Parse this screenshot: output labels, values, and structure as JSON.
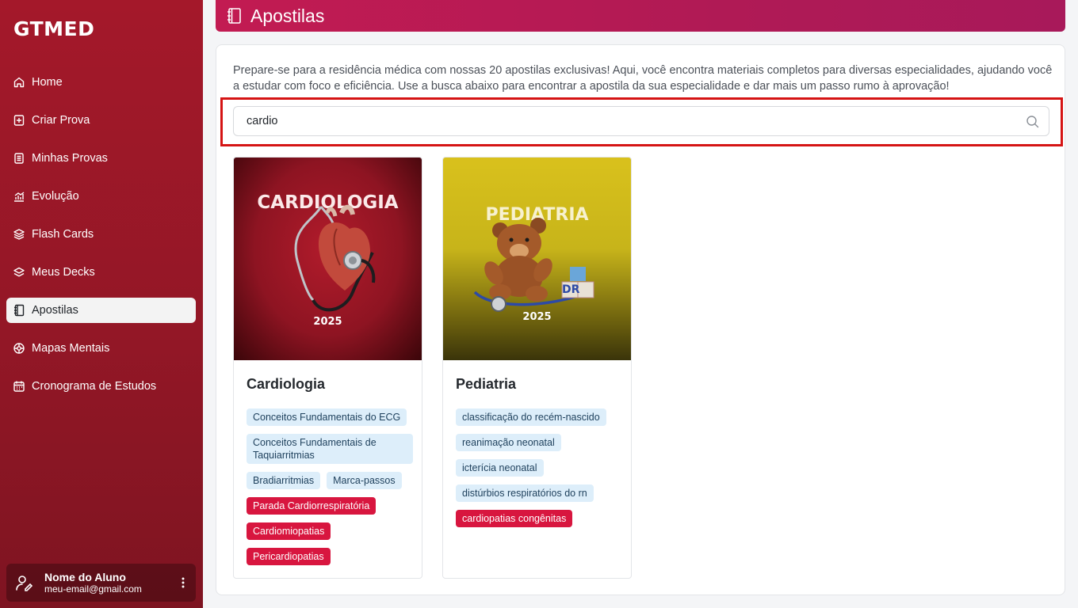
{
  "app": {
    "brand": "GTMED"
  },
  "sidebar": {
    "items": [
      {
        "label": "Home",
        "icon": "home-icon"
      },
      {
        "label": "Criar Prova",
        "icon": "plus-square-icon"
      },
      {
        "label": "Minhas Provas",
        "icon": "document-icon"
      },
      {
        "label": "Evolução",
        "icon": "chart-icon"
      },
      {
        "label": "Flash Cards",
        "icon": "layers-icon"
      },
      {
        "label": "Meus Decks",
        "icon": "stack-icon"
      },
      {
        "label": "Apostilas",
        "icon": "notebook-icon",
        "active": true
      },
      {
        "label": "Mapas Mentais",
        "icon": "mindmap-icon"
      },
      {
        "label": "Cronograma de Estudos",
        "icon": "calendar-icon"
      }
    ]
  },
  "user": {
    "name": "Nome do Aluno",
    "email": "meu-email@gmail.com"
  },
  "header": {
    "title": "Apostilas"
  },
  "main": {
    "description": "Prepare-se para a residência médica com nossas 20 apostilas exclusivas! Aqui, você encontra materiais completos para diversas especialidades, ajudando você a estudar com foco e eficiência. Use a busca abaixo para encontrar a apostila da sua especialidade e dar mais um passo rumo à aprovação!",
    "search": {
      "value": "cardio",
      "placeholder": ""
    }
  },
  "cards": [
    {
      "title": "Cardiologia",
      "cover_title": "CARDIOLOGIA",
      "cover_year": "2025",
      "tags": [
        {
          "label": "Conceitos Fundamentais do ECG",
          "highlight": false
        },
        {
          "label": "Conceitos Fundamentais de Taquiarritmias",
          "highlight": false
        },
        {
          "label": "Bradiarritmias",
          "highlight": false
        },
        {
          "label": "Marca-passos",
          "highlight": false
        },
        {
          "label": "Parada Cardiorrespiratória",
          "highlight": true
        },
        {
          "label": "Cardiomiopatias",
          "highlight": true
        },
        {
          "label": "Pericardiopatias",
          "highlight": true
        }
      ]
    },
    {
      "title": "Pediatria",
      "cover_title": "PEDIATRIA",
      "cover_year": "2025",
      "cover_blocks": "DR",
      "tags": [
        {
          "label": "classificação do recém-nascido",
          "highlight": false
        },
        {
          "label": "reanimação neonatal",
          "highlight": false
        },
        {
          "label": "icterícia neonatal",
          "highlight": false
        },
        {
          "label": "distúrbios respiratórios do rn",
          "highlight": false
        },
        {
          "label": "cardiopatias congênitas",
          "highlight": true
        }
      ]
    }
  ],
  "colors": {
    "sidebar": "#9a1727",
    "header": "#c21b52",
    "highlight_border": "#d51414",
    "tag_bg": "#ddeefa",
    "tag_hit_bg": "#d8163f"
  }
}
